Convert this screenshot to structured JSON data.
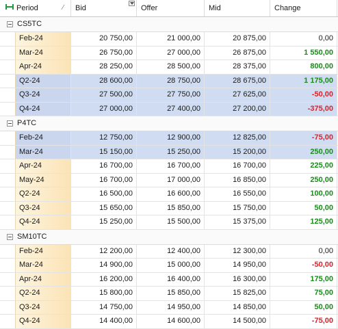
{
  "columns": {
    "period": "Period",
    "bid": "Bid",
    "offer": "Offer",
    "mid": "Mid",
    "change": "Change"
  },
  "colors": {
    "positive": "#1a8b1a",
    "negative": "#e0202a",
    "selection": "#cfdcf1",
    "period_gradient": "#fbe3b6"
  },
  "groups": [
    {
      "name": "CS5TC",
      "rows": [
        {
          "period": "Feb-24",
          "bid": "20 750,00",
          "offer": "21 000,00",
          "mid": "20 875,00",
          "change": "0,00",
          "dir": "zero",
          "selected": false
        },
        {
          "period": "Mar-24",
          "bid": "26 750,00",
          "offer": "27 000,00",
          "mid": "26 875,00",
          "change": "1 550,00",
          "dir": "pos",
          "selected": false
        },
        {
          "period": "Apr-24",
          "bid": "28 250,00",
          "offer": "28 500,00",
          "mid": "28 375,00",
          "change": "800,00",
          "dir": "pos",
          "selected": false
        },
        {
          "period": "Q2-24",
          "bid": "28 600,00",
          "offer": "28 750,00",
          "mid": "28 675,00",
          "change": "1 175,00",
          "dir": "pos",
          "selected": true
        },
        {
          "period": "Q3-24",
          "bid": "27 500,00",
          "offer": "27 750,00",
          "mid": "27 625,00",
          "change": "-50,00",
          "dir": "neg",
          "selected": true
        },
        {
          "period": "Q4-24",
          "bid": "27 000,00",
          "offer": "27 400,00",
          "mid": "27 200,00",
          "change": "-375,00",
          "dir": "neg",
          "selected": true
        }
      ]
    },
    {
      "name": "P4TC",
      "rows": [
        {
          "period": "Feb-24",
          "bid": "12 750,00",
          "offer": "12 900,00",
          "mid": "12 825,00",
          "change": "-75,00",
          "dir": "neg",
          "selected": true
        },
        {
          "period": "Mar-24",
          "bid": "15 150,00",
          "offer": "15 250,00",
          "mid": "15 200,00",
          "change": "250,00",
          "dir": "pos",
          "selected": true
        },
        {
          "period": "Apr-24",
          "bid": "16 700,00",
          "offer": "16 700,00",
          "mid": "16 700,00",
          "change": "225,00",
          "dir": "pos",
          "selected": false
        },
        {
          "period": "May-24",
          "bid": "16 700,00",
          "offer": "17 000,00",
          "mid": "16 850,00",
          "change": "250,00",
          "dir": "pos",
          "selected": false
        },
        {
          "period": "Q2-24",
          "bid": "16 500,00",
          "offer": "16 600,00",
          "mid": "16 550,00",
          "change": "100,00",
          "dir": "pos",
          "selected": false
        },
        {
          "period": "Q3-24",
          "bid": "15 650,00",
          "offer": "15 850,00",
          "mid": "15 750,00",
          "change": "50,00",
          "dir": "pos",
          "selected": false
        },
        {
          "period": "Q4-24",
          "bid": "15 250,00",
          "offer": "15 500,00",
          "mid": "15 375,00",
          "change": "125,00",
          "dir": "pos",
          "selected": false
        }
      ]
    },
    {
      "name": "SM10TC",
      "rows": [
        {
          "period": "Feb-24",
          "bid": "12 200,00",
          "offer": "12 400,00",
          "mid": "12 300,00",
          "change": "0,00",
          "dir": "zero",
          "selected": false
        },
        {
          "period": "Mar-24",
          "bid": "14 900,00",
          "offer": "15 000,00",
          "mid": "14 950,00",
          "change": "-50,00",
          "dir": "neg",
          "selected": false
        },
        {
          "period": "Apr-24",
          "bid": "16 200,00",
          "offer": "16 400,00",
          "mid": "16 300,00",
          "change": "175,00",
          "dir": "pos",
          "selected": false
        },
        {
          "period": "Q2-24",
          "bid": "15 800,00",
          "offer": "15 850,00",
          "mid": "15 825,00",
          "change": "75,00",
          "dir": "pos",
          "selected": false
        },
        {
          "period": "Q3-24",
          "bid": "14 750,00",
          "offer": "14 950,00",
          "mid": "14 850,00",
          "change": "50,00",
          "dir": "pos",
          "selected": false
        },
        {
          "period": "Q4-24",
          "bid": "14 400,00",
          "offer": "14 600,00",
          "mid": "14 500,00",
          "change": "-75,00",
          "dir": "neg",
          "selected": false
        }
      ]
    }
  ]
}
